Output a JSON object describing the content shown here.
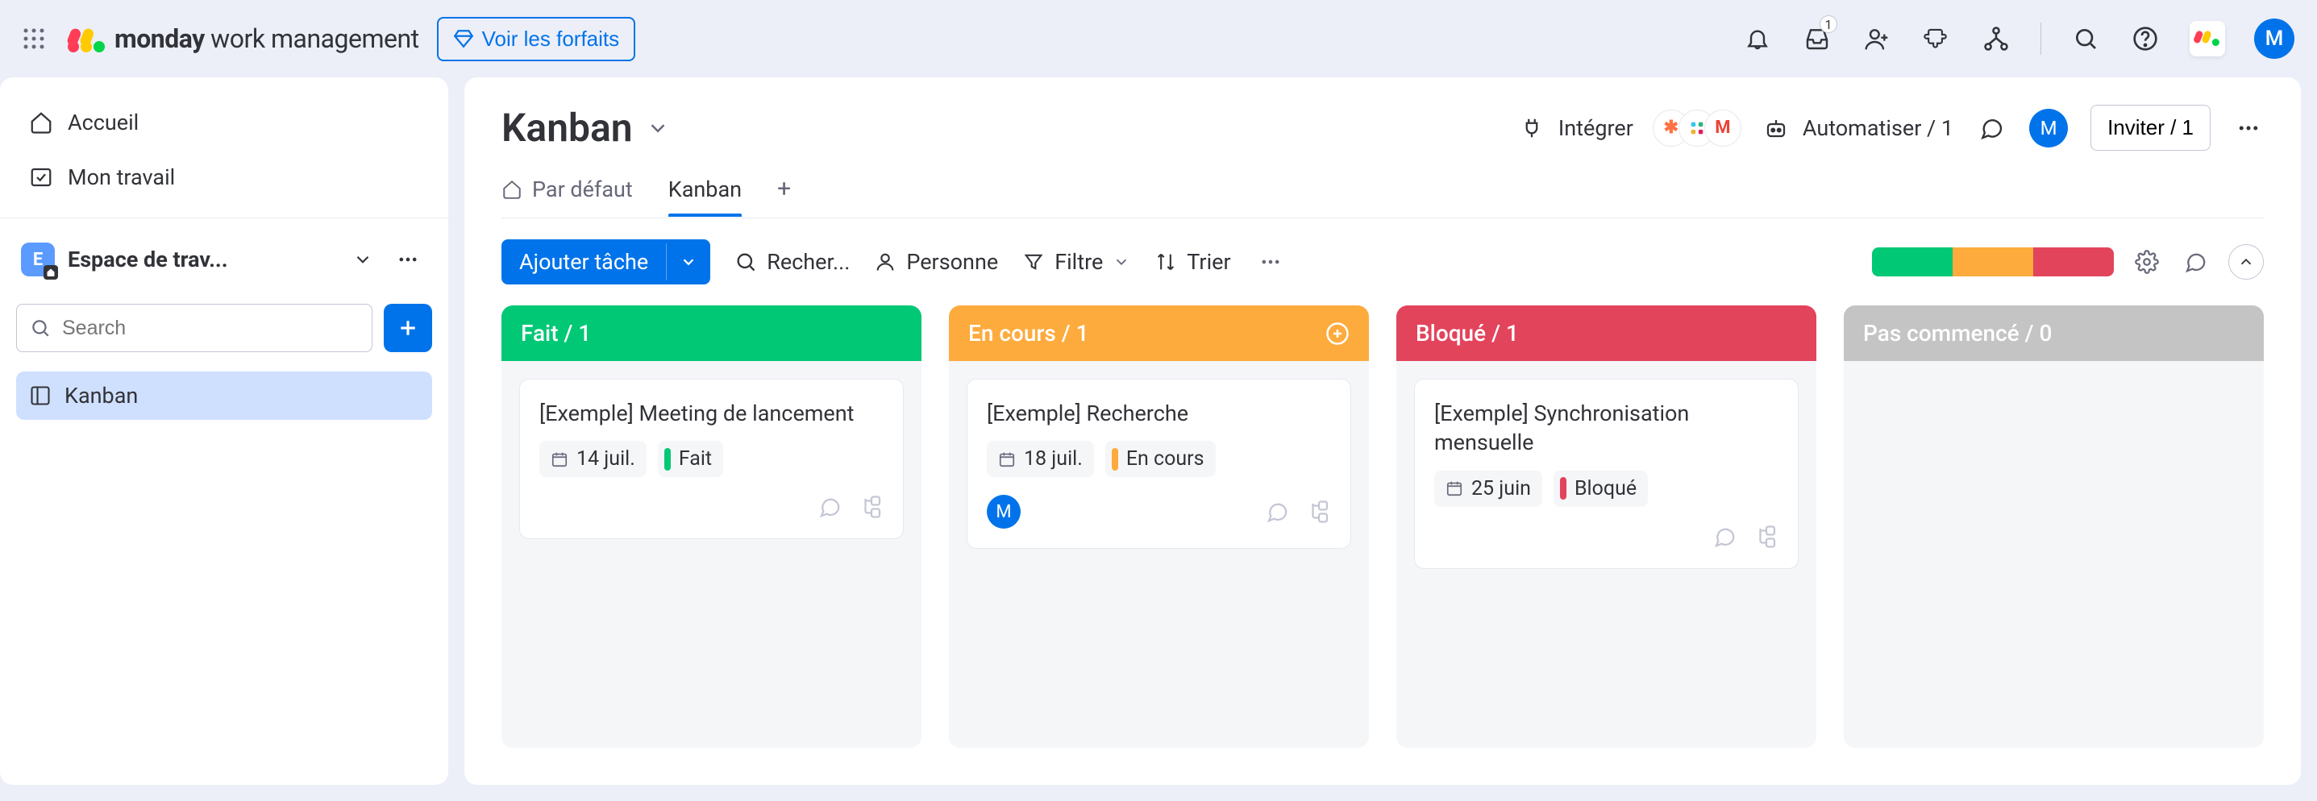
{
  "brand": {
    "bold": "monday",
    "light": "work management"
  },
  "topbar": {
    "plans_label": "Voir les forfaits",
    "inbox_badge": "1",
    "avatar_initial": "M"
  },
  "sidebar": {
    "home_label": "Accueil",
    "mywork_label": "Mon travail",
    "workspace_name": "Espace de trav...",
    "workspace_initial": "E",
    "search_placeholder": "Search",
    "board_label": "Kanban"
  },
  "board": {
    "title": "Kanban",
    "integrate_label": "Intégrer",
    "automate_label": "Automatiser / 1",
    "invite_label": "Inviter / 1",
    "member_initial": "M"
  },
  "tabs": {
    "default_label": "Par défaut",
    "kanban_label": "Kanban"
  },
  "toolbar": {
    "add_label": "Ajouter tâche",
    "search_label": "Recher...",
    "person_label": "Personne",
    "filter_label": "Filtre",
    "sort_label": "Trier"
  },
  "columns": {
    "done": {
      "title": "Fait / 1",
      "color": "#00c875"
    },
    "doing": {
      "title": "En cours / 1",
      "color": "#fdab3d"
    },
    "blocked": {
      "title": "Bloqué / 1",
      "color": "#e2445c"
    },
    "todo": {
      "title": "Pas commencé / 0",
      "color": "#c4c4c4"
    }
  },
  "cards": {
    "done": {
      "title": "[Exemple] Meeting de lancement",
      "date": "14 juil.",
      "status": "Fait",
      "status_color": "#00c875"
    },
    "doing": {
      "title": "[Exemple] Recherche",
      "date": "18 juil.",
      "status": "En cours",
      "status_color": "#fdab3d",
      "assignee_initial": "M"
    },
    "blocked": {
      "title": "[Exemple] Synchronisation mensuelle",
      "date": "25 juin",
      "status": "Bloqué",
      "status_color": "#e2445c"
    }
  }
}
